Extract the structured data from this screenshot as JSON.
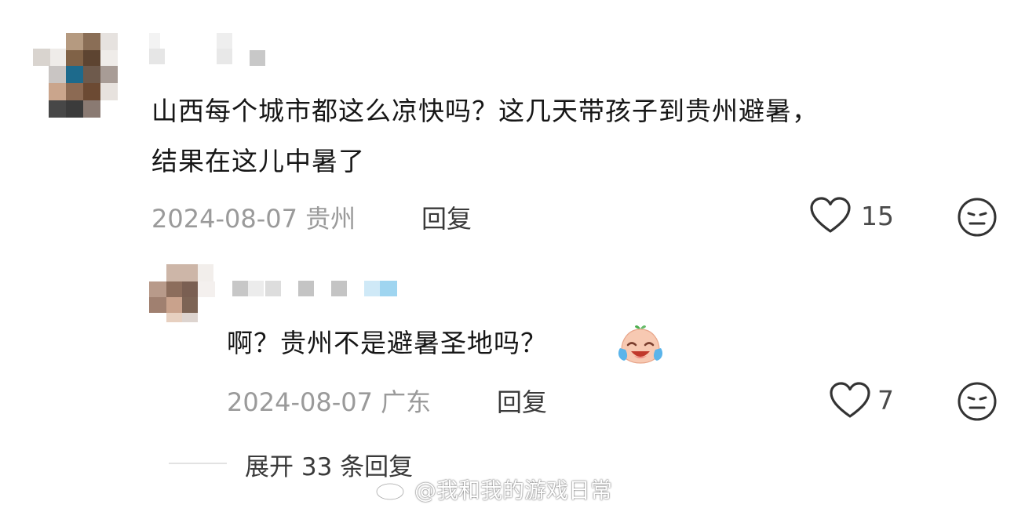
{
  "comments": [
    {
      "text_lines": [
        "山西每个城市都这么凉快吗？这几天带孩子到贵州避暑，",
        "结果在这儿中暑了"
      ],
      "date": "2024-08-07",
      "location": "贵州",
      "reply_label": "回复",
      "like_count": "15",
      "like_icon": "heart-outline-icon",
      "dislike_icon": "neutral-face-icon"
    }
  ],
  "reply": {
    "text": "啊？贵州不是避暑圣地吗？",
    "emoji": "laughing-crying-emoji",
    "date": "2024-08-07",
    "location": "广东",
    "reply_label": "回复",
    "like_count": "7"
  },
  "expand": {
    "label": "展开 33 条回复"
  },
  "watermark": {
    "text": "@我和我的游戏日常",
    "icon": "weibo-logo-icon"
  },
  "colors": {
    "text": "#161616",
    "meta": "#9a9a9a",
    "reply_link": "#3a3a3a",
    "icon_stroke": "#333333",
    "background": "#ffffff"
  }
}
